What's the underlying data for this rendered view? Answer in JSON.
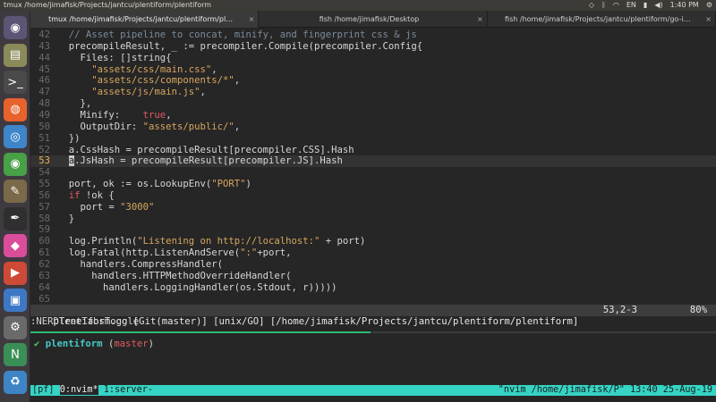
{
  "system_bar": {
    "title": "tmux /home/jimafisk/Projects/jantcu/plentiform/plentiform",
    "keyboard_layout": "EN",
    "time": "1:40 PM"
  },
  "launcher": {
    "items": [
      {
        "name": "ubuntu-dash-icon",
        "glyph": "◉",
        "color": "#5e5476"
      },
      {
        "name": "files-icon",
        "glyph": "▤",
        "color": "#8a8a5a"
      },
      {
        "name": "terminal-icon",
        "glyph": ">_",
        "color": "#4a4a4a"
      },
      {
        "name": "firefox-icon",
        "glyph": "◍",
        "color": "#e8622d"
      },
      {
        "name": "chromium-icon",
        "glyph": "◎",
        "color": "#3e86c9"
      },
      {
        "name": "chrome-icon",
        "glyph": "◉",
        "color": "#48a047"
      },
      {
        "name": "gimp-icon",
        "glyph": "✎",
        "color": "#7a6a4a"
      },
      {
        "name": "inkscape-icon",
        "glyph": "✒",
        "color": "#2f2f2f"
      },
      {
        "name": "kite-icon",
        "glyph": "◆",
        "color": "#d94d9a"
      },
      {
        "name": "media-icon",
        "glyph": "▶",
        "color": "#cf4a36"
      },
      {
        "name": "vm-icon",
        "glyph": "▣",
        "color": "#3d78c4"
      },
      {
        "name": "settings-icon",
        "glyph": "⚙",
        "color": "#6a6a6a"
      },
      {
        "name": "node-icon",
        "glyph": "N",
        "color": "#3a8f57"
      },
      {
        "name": "trash-icon",
        "glyph": "♻",
        "color": "#3d85c6"
      }
    ]
  },
  "tabs": [
    {
      "label": "tmux /home/jimafisk/Projects/jantcu/plentiform/pl…",
      "active": true
    },
    {
      "label": "fish /home/jimafisk/Desktop",
      "active": false
    },
    {
      "label": "fish /home/jimafisk/Projects/jantcu/plentiform/go-i…",
      "active": false
    }
  ],
  "editor": {
    "lines": [
      {
        "n": "42",
        "parts": [
          {
            "t": "  // Asset pipeline to concat, minify, and fingerprint css & js",
            "c": "com"
          }
        ]
      },
      {
        "n": "43",
        "parts": [
          {
            "t": "  precompileResult, _ := precompiler.Compile(precompiler.Config{",
            "c": ""
          }
        ]
      },
      {
        "n": "44",
        "parts": [
          {
            "t": "    Files: []string{",
            "c": ""
          }
        ]
      },
      {
        "n": "45",
        "parts": [
          {
            "t": "      ",
            "c": ""
          },
          {
            "t": "\"assets/css/main.css\"",
            "c": "str"
          },
          {
            "t": ",",
            "c": ""
          }
        ]
      },
      {
        "n": "46",
        "parts": [
          {
            "t": "      ",
            "c": ""
          },
          {
            "t": "\"assets/css/components/*\"",
            "c": "str"
          },
          {
            "t": ",",
            "c": ""
          }
        ]
      },
      {
        "n": "47",
        "parts": [
          {
            "t": "      ",
            "c": ""
          },
          {
            "t": "\"assets/js/main.js\"",
            "c": "str"
          },
          {
            "t": ",",
            "c": ""
          }
        ]
      },
      {
        "n": "48",
        "parts": [
          {
            "t": "    },",
            "c": ""
          }
        ]
      },
      {
        "n": "49",
        "parts": [
          {
            "t": "    Minify:    ",
            "c": ""
          },
          {
            "t": "true",
            "c": "kw"
          },
          {
            "t": ",",
            "c": ""
          }
        ]
      },
      {
        "n": "50",
        "parts": [
          {
            "t": "    OutputDir: ",
            "c": ""
          },
          {
            "t": "\"assets/public/\"",
            "c": "str"
          },
          {
            "t": ",",
            "c": ""
          }
        ]
      },
      {
        "n": "51",
        "parts": [
          {
            "t": "  })",
            "c": ""
          }
        ]
      },
      {
        "n": "52",
        "parts": [
          {
            "t": "  a.CssHash = precompileResult[precompiler.CSS].Hash",
            "c": ""
          }
        ]
      },
      {
        "n": "53",
        "cur": true,
        "parts": [
          {
            "t": "  ",
            "c": ""
          },
          {
            "t": "a",
            "c": "cursor"
          },
          {
            "t": ".JsHash = precompileResult[precompiler.JS].Hash",
            "c": ""
          }
        ]
      },
      {
        "n": "54",
        "parts": [
          {
            "t": "",
            "c": ""
          }
        ]
      },
      {
        "n": "55",
        "parts": [
          {
            "t": "  port, ok := os.LookupEnv(",
            "c": ""
          },
          {
            "t": "\"PORT\"",
            "c": "str"
          },
          {
            "t": ")",
            "c": ""
          }
        ]
      },
      {
        "n": "56",
        "parts": [
          {
            "t": "  ",
            "c": ""
          },
          {
            "t": "if",
            "c": "kw"
          },
          {
            "t": " !ok {",
            "c": ""
          }
        ]
      },
      {
        "n": "57",
        "parts": [
          {
            "t": "    port = ",
            "c": ""
          },
          {
            "t": "\"3000\"",
            "c": "str"
          }
        ]
      },
      {
        "n": "58",
        "parts": [
          {
            "t": "  }",
            "c": ""
          }
        ]
      },
      {
        "n": "59",
        "parts": [
          {
            "t": "",
            "c": ""
          }
        ]
      },
      {
        "n": "60",
        "parts": [
          {
            "t": "  log.Println(",
            "c": ""
          },
          {
            "t": "\"Listening on http://localhost:\"",
            "c": "str"
          },
          {
            "t": " + port)",
            "c": ""
          }
        ]
      },
      {
        "n": "61",
        "parts": [
          {
            "t": "  log.Fatal(http.ListenAndServe(",
            "c": ""
          },
          {
            "t": "\":\"",
            "c": "str"
          },
          {
            "t": "+port,",
            "c": ""
          }
        ]
      },
      {
        "n": "62",
        "parts": [
          {
            "t": "    handlers.CompressHandler(",
            "c": ""
          }
        ]
      },
      {
        "n": "63",
        "parts": [
          {
            "t": "      handlers.HTTPMethodOverrideHandler(",
            "c": ""
          }
        ]
      },
      {
        "n": "64",
        "parts": [
          {
            "t": "        handlers.LoggingHandler(os.Stdout, r)))))",
            "c": ""
          }
        ]
      },
      {
        "n": "65",
        "parts": [
          {
            "t": "",
            "c": ""
          }
        ]
      }
    ],
    "statusline": {
      "left": "plentiform.go [Git(master)] [unix/GO] [/home/jimafisk/Projects/jantcu/plentiform/plentiform]",
      "position": "53,2-3",
      "percent": "80%"
    },
    "cmdline": ":NERDTreeTabsToggle"
  },
  "shell": {
    "check": "✔",
    "dir": "plentiform",
    "branch": "master"
  },
  "tmux": {
    "session": "[pf]",
    "win0": "0:nvim*",
    "win1": "1:server-",
    "right": "\"nvim /home/jimafisk/P\" 13:40 25-Aug-19"
  }
}
